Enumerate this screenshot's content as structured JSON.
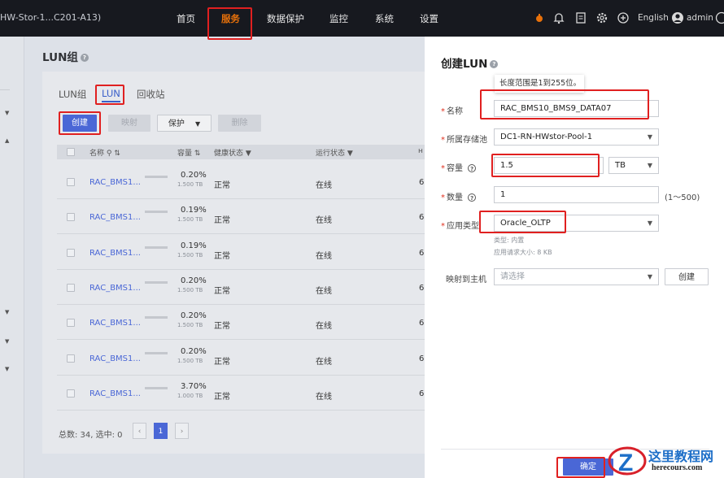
{
  "topbar": {
    "title": "HW-Stor-1...C201-A13)",
    "nav": [
      "首页",
      "服务",
      "数据保护",
      "监控",
      "系统",
      "设置"
    ],
    "active_nav": "服务",
    "language": "English",
    "user": "admin"
  },
  "page": {
    "title": "LUN组",
    "tabs": [
      "LUN组",
      "LUN",
      "回收站"
    ],
    "active_tab": "LUN",
    "toolbar": {
      "create": "创建",
      "map": "映射",
      "protect": "保护",
      "delete": "删除"
    },
    "columns": {
      "name": "名称",
      "capacity": "容量",
      "health": "健康状态",
      "running": "运行状态",
      "extra": "н"
    },
    "rows": [
      {
        "name": "RAC_BMS1...",
        "usage": "0.20%",
        "capacity": "1.500 TB",
        "health": "正常",
        "running": "在线",
        "extra": "6"
      },
      {
        "name": "RAC_BMS1...",
        "usage": "0.19%",
        "capacity": "1.500 TB",
        "health": "正常",
        "running": "在线",
        "extra": "6"
      },
      {
        "name": "RAC_BMS1...",
        "usage": "0.19%",
        "capacity": "1.500 TB",
        "health": "正常",
        "running": "在线",
        "extra": "6"
      },
      {
        "name": "RAC_BMS1...",
        "usage": "0.20%",
        "capacity": "1.500 TB",
        "health": "正常",
        "running": "在线",
        "extra": "6"
      },
      {
        "name": "RAC_BMS1...",
        "usage": "0.20%",
        "capacity": "1.500 TB",
        "health": "正常",
        "running": "在线",
        "extra": "6"
      },
      {
        "name": "RAC_BMS1...",
        "usage": "0.20%",
        "capacity": "1.500 TB",
        "health": "正常",
        "running": "在线",
        "extra": "6"
      },
      {
        "name": "RAC_BMS1...",
        "usage": "3.70%",
        "capacity": "1.000 TB",
        "health": "正常",
        "running": "在线",
        "extra": "6"
      }
    ],
    "footer": {
      "summary": "总数: 34,  选中: 0",
      "current_page": "1"
    }
  },
  "drawer": {
    "title": "创建LUN",
    "tooltip": "长度范围是1到255位。",
    "name_label": "名称",
    "name_value": "RAC_BMS10_BMS9_DATA07",
    "pool_label": "所属存储池",
    "pool_value": "DC1-RN-HWstor-Pool-1",
    "capacity_label": "容量",
    "capacity_value": "1.5",
    "capacity_unit": "TB",
    "count_label": "数量",
    "count_value": "1",
    "count_range": "(1～500)",
    "apptype_label": "应用类型",
    "apptype_value": "Oracle_OLTP",
    "apptype_hint1": "类型: 内置",
    "apptype_hint2": "应用请求大小: 8 KB",
    "map_label": "映射到主机",
    "map_placeholder": "请选择",
    "map_create": "创建",
    "confirm": "确定"
  },
  "watermark": {
    "line1": "这里教程网",
    "line2": "herecours.com"
  },
  "colors": {
    "accent": "#4a67d6",
    "active_nav": "#e8710a",
    "annotation": "#e02020"
  }
}
